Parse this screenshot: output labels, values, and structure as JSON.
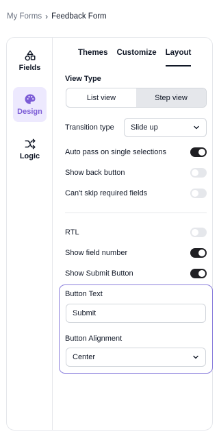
{
  "breadcrumb": {
    "parent": "My Forms",
    "separator": "›",
    "current": "Feedback Form"
  },
  "sidebar": {
    "items": [
      {
        "label": "Fields",
        "icon": "shapes-icon",
        "active": false
      },
      {
        "label": "Design",
        "icon": "palette-icon",
        "active": true
      },
      {
        "label": "Logic",
        "icon": "shuffle-icon",
        "active": false
      }
    ]
  },
  "tabs": [
    {
      "label": "Themes",
      "active": false
    },
    {
      "label": "Customize",
      "active": false
    },
    {
      "label": "Layout",
      "active": true
    }
  ],
  "view_type": {
    "title": "View Type",
    "options": [
      "List view",
      "Step view"
    ],
    "selected": "Step view"
  },
  "transition": {
    "label": "Transition type",
    "value": "Slide up"
  },
  "toggles": {
    "auto_pass": {
      "label": "Auto pass on single selections",
      "on": true
    },
    "back_button": {
      "label": "Show back button",
      "on": false
    },
    "cant_skip": {
      "label": "Can't skip required fields",
      "on": false
    },
    "rtl": {
      "label": "RTL",
      "on": false
    },
    "field_number": {
      "label": "Show field number",
      "on": true
    },
    "submit_button": {
      "label": "Show Submit Button",
      "on": true
    }
  },
  "button_text": {
    "label": "Button Text",
    "value": "Submit"
  },
  "button_alignment": {
    "label": "Button Alignment",
    "value": "Center"
  },
  "colors": {
    "accent": "#7c5cd6",
    "accent_bg": "#ede9fe",
    "toggle_on": "#1f1f23",
    "toggle_off": "#e5e7eb",
    "highlight_border": "#8b7fdc"
  }
}
